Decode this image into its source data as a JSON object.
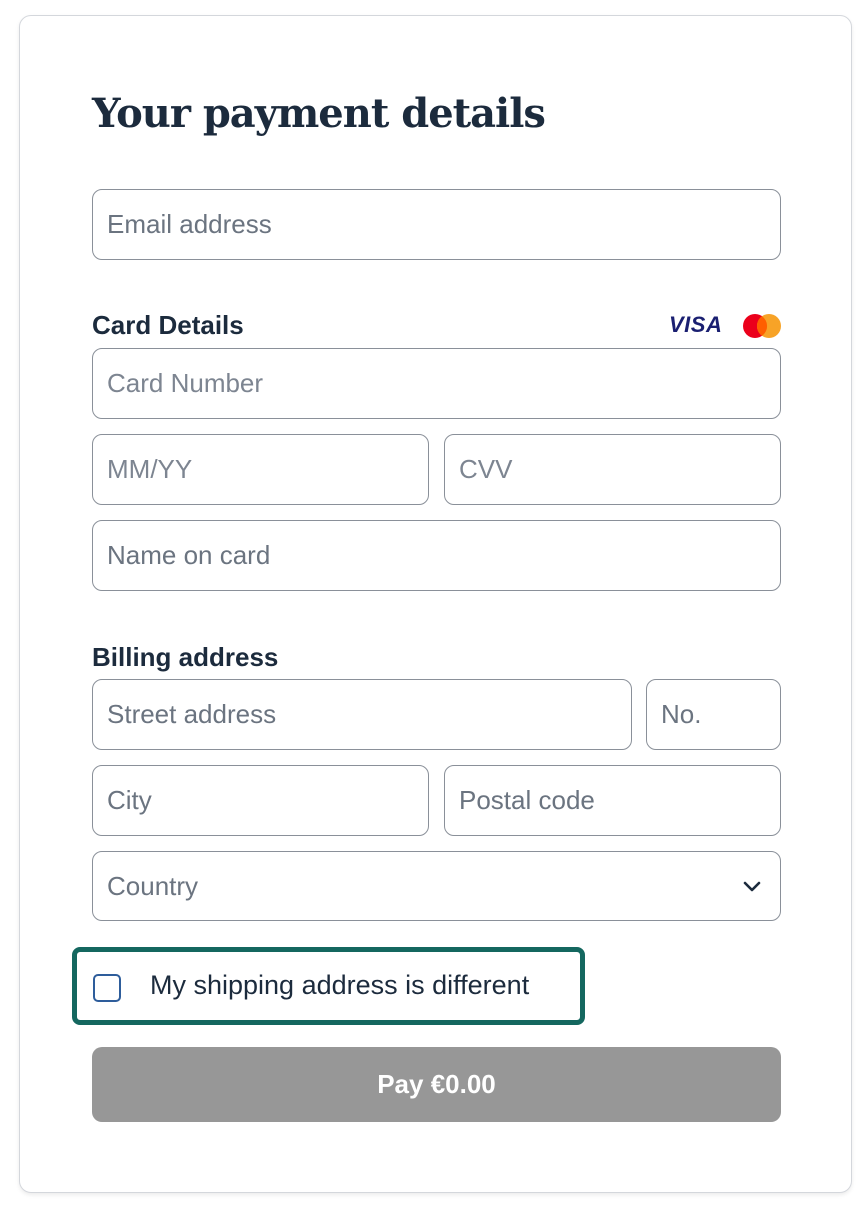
{
  "form": {
    "title": "Your payment details",
    "email_placeholder": "Email address",
    "card_section_label": "Card Details",
    "card_brands": [
      "VISA",
      "mastercard"
    ],
    "card_number_placeholder": "Card Number",
    "expiry_placeholder": "MM/YY",
    "cvv_placeholder": "CVV",
    "name_on_card_placeholder": "Name on card",
    "billing_section_label": "Billing address",
    "street_placeholder": "Street address",
    "house_number_placeholder": "No.",
    "city_placeholder": "City",
    "postal_code_placeholder": "Postal code",
    "country_placeholder": "Country",
    "shipping_checkbox_label": "My shipping address is different",
    "shipping_checkbox_checked": false,
    "pay_button_label": "Pay €0.00"
  },
  "colors": {
    "focus_ring": "#14675f",
    "pay_button_disabled": "#979797",
    "visa_blue": "#1a1f71",
    "mastercard_red": "#eb001b",
    "mastercard_orange": "#f79e1b"
  }
}
